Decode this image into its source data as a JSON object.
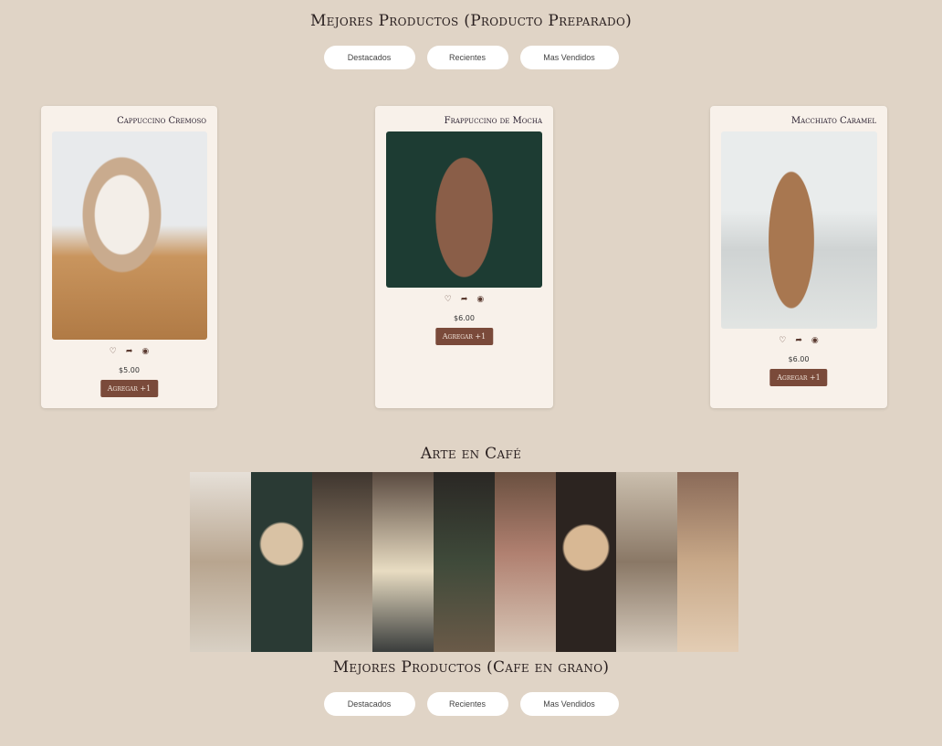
{
  "section1": {
    "title": "Mejores Productos (Producto Preparado)",
    "tabs": [
      "Destacados",
      "Recientes",
      "Mas Vendidos"
    ]
  },
  "products": [
    {
      "name": "Cappuccino Cremoso",
      "price": "$5.00",
      "button": "Agregar +1"
    },
    {
      "name": "Frappuccino de Mocha",
      "price": "$6.00",
      "button": "Agregar +1"
    },
    {
      "name": "Macchiato Caramel",
      "price": "$6.00",
      "button": "Agregar +1"
    }
  ],
  "icons": {
    "heart": "♡",
    "share": "➦",
    "view": "◉"
  },
  "art": {
    "title": "Arte en Café"
  },
  "section2": {
    "title": "Mejores Productos (Cafe en grano)",
    "tabs": [
      "Destacados",
      "Recientes",
      "Mas Vendidos"
    ]
  }
}
